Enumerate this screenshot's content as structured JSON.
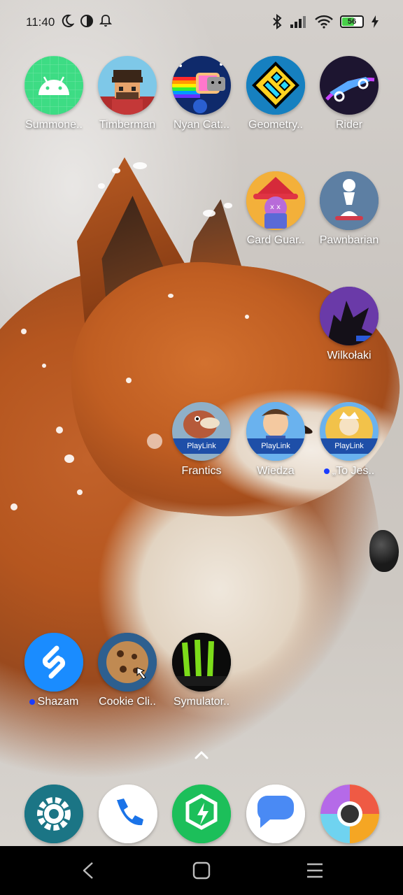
{
  "status": {
    "time": "11:40",
    "battery": "56",
    "left_icons": [
      "moon-icon",
      "data-saver-icon",
      "bell-icon"
    ],
    "right_icons": [
      "bluetooth-icon",
      "signal-icon",
      "wifi-icon",
      "battery-icon",
      "charging-icon"
    ]
  },
  "apps": {
    "summoner": {
      "label": "Summone.."
    },
    "timberman": {
      "label": "Timberman"
    },
    "nyancat": {
      "label": "Nyan Cat:.."
    },
    "geometry": {
      "label": "Geometry.."
    },
    "rider": {
      "label": "Rider"
    },
    "cardguar": {
      "label": "Card Guar.."
    },
    "pawnbarian": {
      "label": "Pawnbarian"
    },
    "wilkolaki": {
      "label": "Wilkołaki"
    },
    "frantics": {
      "label": "Frantics",
      "badge": "PlayLink"
    },
    "wiedza": {
      "label": "Wiedza",
      "badge": "PlayLink"
    },
    "tojes": {
      "label": "„To Jes..",
      "badge": "PlayLink"
    },
    "shazam": {
      "label": "Shazam"
    },
    "cookie": {
      "label": "Cookie Cli.."
    },
    "symulator": {
      "label": "Symulator.."
    }
  },
  "dock": [
    "settings-icon",
    "phone-icon",
    "security-icon",
    "messages-icon",
    "chrome-icon"
  ],
  "nav": [
    "back-button",
    "home-button",
    "recents-button"
  ],
  "colors": {
    "notification_dot": "#1a3cff",
    "battery_fill": "#48d14a",
    "navbar": "#000000"
  }
}
